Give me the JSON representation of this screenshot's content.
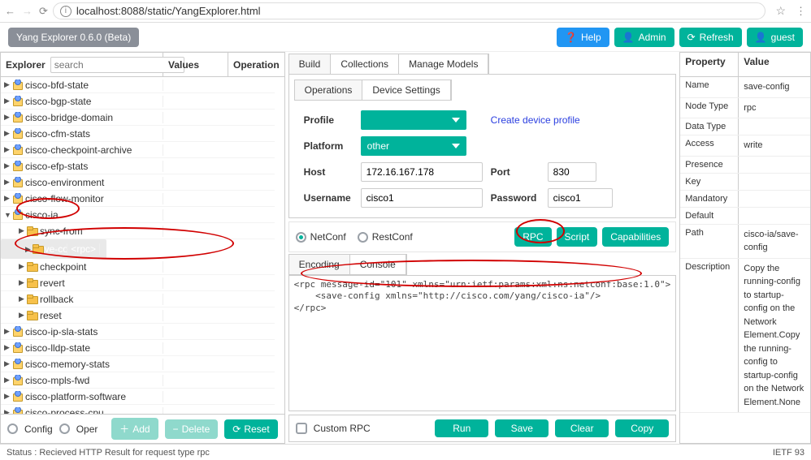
{
  "browser": {
    "url": "localhost:8088/static/YangExplorer.html"
  },
  "app": {
    "badge": "Yang Explorer 0.6.0 (Beta)"
  },
  "topbuttons": {
    "help": "Help",
    "admin": "Admin",
    "refresh": "Refresh",
    "guest": "guest"
  },
  "explorer": {
    "title": "Explorer",
    "search_ph": "search",
    "col_values": "Values",
    "col_operation": "Operation",
    "footer": {
      "config": "Config",
      "oper": "Oper",
      "add": "Add",
      "delete": "Delete",
      "reset": "Reset"
    },
    "tree": [
      {
        "t": "mod",
        "ind": 0,
        "label": "cisco-bfd-state"
      },
      {
        "t": "mod",
        "ind": 0,
        "label": "cisco-bgp-state"
      },
      {
        "t": "mod",
        "ind": 0,
        "label": "cisco-bridge-domain"
      },
      {
        "t": "mod",
        "ind": 0,
        "label": "cisco-cfm-stats"
      },
      {
        "t": "mod",
        "ind": 0,
        "label": "cisco-checkpoint-archive"
      },
      {
        "t": "mod",
        "ind": 0,
        "label": "cisco-efp-stats"
      },
      {
        "t": "mod",
        "ind": 0,
        "label": "cisco-environment"
      },
      {
        "t": "mod",
        "ind": 0,
        "label": "cisco-flow-monitor"
      },
      {
        "t": "mod",
        "ind": 0,
        "label": "cisco-ia",
        "open": true
      },
      {
        "t": "fld",
        "ind": 1,
        "label": "sync-from"
      },
      {
        "t": "fld",
        "ind": 1,
        "label": "save-config",
        "value": "<rpc>",
        "sel": true
      },
      {
        "t": "fld",
        "ind": 1,
        "label": "checkpoint"
      },
      {
        "t": "fld",
        "ind": 1,
        "label": "revert"
      },
      {
        "t": "fld",
        "ind": 1,
        "label": "rollback"
      },
      {
        "t": "fld",
        "ind": 1,
        "label": "reset"
      },
      {
        "t": "mod",
        "ind": 0,
        "label": "cisco-ip-sla-stats"
      },
      {
        "t": "mod",
        "ind": 0,
        "label": "cisco-lldp-state"
      },
      {
        "t": "mod",
        "ind": 0,
        "label": "cisco-memory-stats"
      },
      {
        "t": "mod",
        "ind": 0,
        "label": "cisco-mpls-fwd"
      },
      {
        "t": "mod",
        "ind": 0,
        "label": "cisco-platform-software"
      },
      {
        "t": "mod",
        "ind": 0,
        "label": "cisco-process-cpu"
      }
    ]
  },
  "mid": {
    "tabs": {
      "build": "Build",
      "collections": "Collections",
      "manage": "Manage Models"
    },
    "subtabs": {
      "operations": "Operations",
      "device": "Device Settings"
    },
    "form": {
      "profile_lbl": "Profile",
      "profile_val": "",
      "create_link": "Create device profile",
      "platform_lbl": "Platform",
      "platform_val": "other",
      "host_lbl": "Host",
      "host_val": "172.16.167.178",
      "port_lbl": "Port",
      "port_val": "830",
      "user_lbl": "Username",
      "user_val": "cisco1",
      "pass_lbl": "Password",
      "pass_val": "cisco1"
    },
    "proto": {
      "netconf": "NetConf",
      "restconf": "RestConf",
      "rpc": "RPC",
      "script": "Script",
      "caps": "Capabilities"
    },
    "enc": {
      "encoding": "Encoding",
      "console": "Console"
    },
    "code": "<rpc message-id=\"101\" xmlns=\"urn:ietf:params:xml:ns:netconf:base:1.0\">\n    <save-config xmlns=\"http://cisco.com/yang/cisco-ia\"/>\n</rpc>",
    "bottom": {
      "custom": "Custom RPC",
      "run": "Run",
      "save": "Save",
      "clear": "Clear",
      "copy": "Copy"
    }
  },
  "props": {
    "hdr_prop": "Property",
    "hdr_val": "Value",
    "rows": [
      {
        "k": "Name",
        "v": "save-config"
      },
      {
        "k": "Node Type",
        "v": "rpc"
      },
      {
        "k": "Data Type",
        "v": ""
      },
      {
        "k": "Access",
        "v": "write"
      },
      {
        "k": "Presence",
        "v": ""
      },
      {
        "k": "Key",
        "v": ""
      },
      {
        "k": "Mandatory",
        "v": ""
      },
      {
        "k": "Default",
        "v": ""
      },
      {
        "k": "Path",
        "v": "cisco-ia/save-config"
      },
      {
        "k": "Description",
        "v": "Copy the running-config to startup-config on the Network Element.Copy the running-config to startup-config on the Network Element.None"
      }
    ]
  },
  "status": {
    "left": "Status : Recieved HTTP Result for request type rpc",
    "right": "IETF 93"
  }
}
